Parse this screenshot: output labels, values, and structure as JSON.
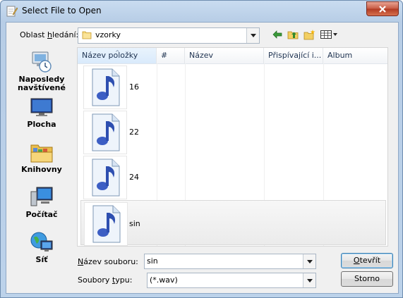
{
  "window": {
    "title": "Select File to Open"
  },
  "lookin": {
    "label_pre": "Oblast ",
    "label_u": "h",
    "label_post": "ledání:",
    "value": "vzorky"
  },
  "places": [
    {
      "label": "Naposledy navštívené"
    },
    {
      "label": "Plocha"
    },
    {
      "label": "Knihovny"
    },
    {
      "label": "Počítač"
    },
    {
      "label": "Síť"
    }
  ],
  "columns": [
    "Název položky",
    "#",
    "Název",
    "Přispívající i...",
    "Album"
  ],
  "files": [
    {
      "name": "16"
    },
    {
      "name": "22"
    },
    {
      "name": "24"
    },
    {
      "name": "sin"
    }
  ],
  "filename": {
    "label_u": "N",
    "label_rest": "ázev souboru:",
    "value": "sin"
  },
  "filetype": {
    "label_pre": "Soubory ",
    "label_u": "t",
    "label_post": "ypu:",
    "value": "(*.wav)"
  },
  "buttons": {
    "open_u": "O",
    "open_rest": "tevřít",
    "cancel": "Storno"
  },
  "colors": {
    "title_accent": "#6f8db0",
    "close_red": "#c75a43"
  }
}
